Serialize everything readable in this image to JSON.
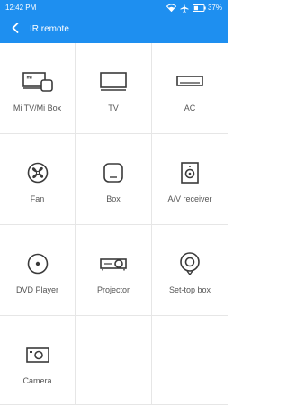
{
  "status": {
    "time": "12:42 PM",
    "battery": "37%"
  },
  "header": {
    "title": "IR remote"
  },
  "devices": [
    {
      "label": "Mi TV/Mi Box",
      "icon": "mitv-mibox-icon"
    },
    {
      "label": "TV",
      "icon": "tv-icon"
    },
    {
      "label": "AC",
      "icon": "ac-icon"
    },
    {
      "label": "Fan",
      "icon": "fan-icon"
    },
    {
      "label": "Box",
      "icon": "box-icon"
    },
    {
      "label": "A/V receiver",
      "icon": "av-receiver-icon"
    },
    {
      "label": "DVD Player",
      "icon": "dvd-player-icon"
    },
    {
      "label": "Projector",
      "icon": "projector-icon"
    },
    {
      "label": "Set-top box",
      "icon": "set-top-box-icon"
    },
    {
      "label": "Camera",
      "icon": "camera-icon"
    }
  ],
  "colors": {
    "accent": "#1e8ff0",
    "icon": "#3a3a3a"
  }
}
